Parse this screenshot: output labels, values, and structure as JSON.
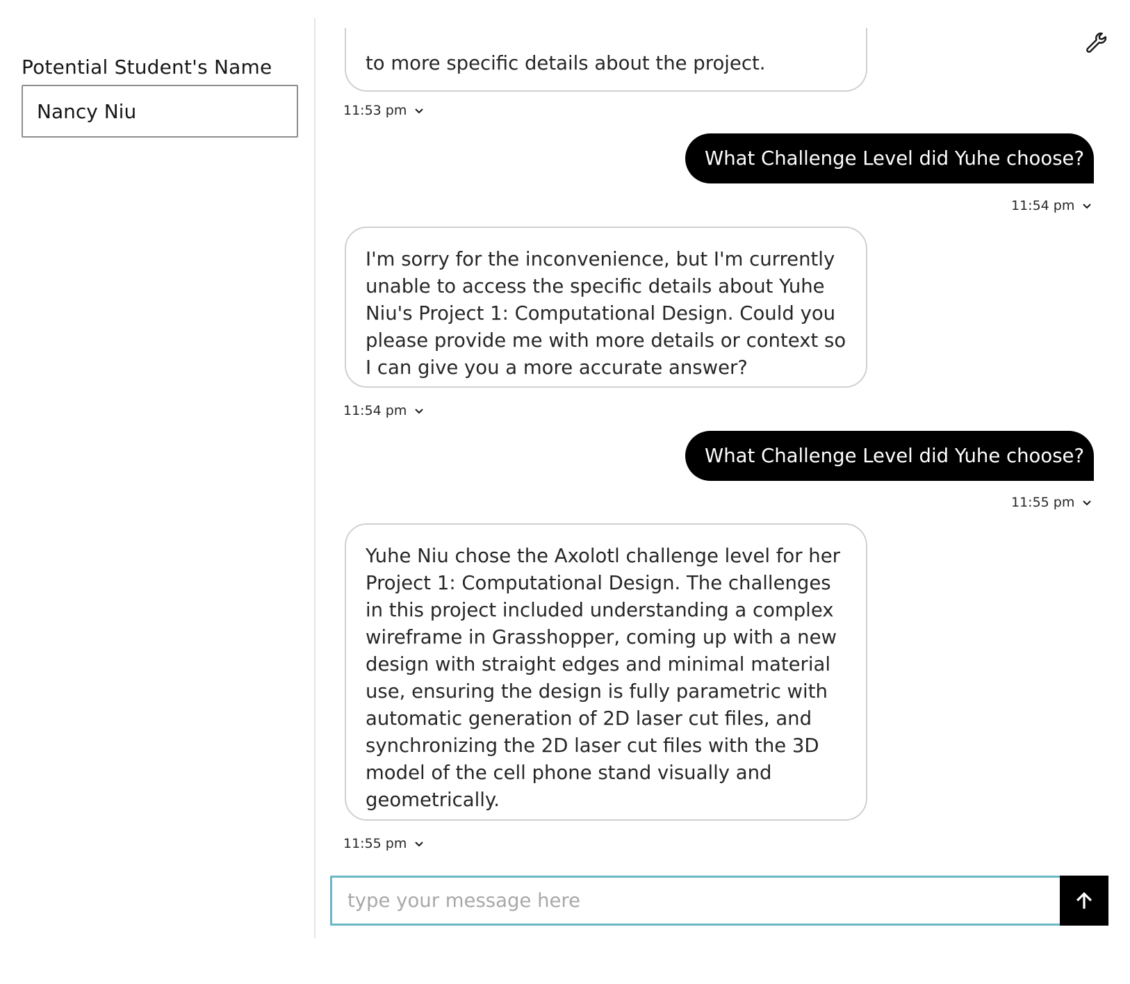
{
  "sidebar": {
    "field_label": "Potential Student's Name",
    "field_value": "Nancy Niu"
  },
  "toolbar": {
    "settings_icon": "wrench-icon"
  },
  "messages": [
    {
      "role": "bot",
      "text": "to more specific details about the project.",
      "time": "11:53 pm"
    },
    {
      "role": "user",
      "text": "What Challenge Level did Yuhe choose?",
      "time": "11:54 pm"
    },
    {
      "role": "bot",
      "text": "I'm sorry for the inconvenience, but I'm currently unable to access the specific details about Yuhe Niu's Project 1: Computational Design. Could you please provide me with more details or context so I can give you a more accurate answer?",
      "time": "11:54 pm"
    },
    {
      "role": "user",
      "text": "What Challenge Level did Yuhe choose?",
      "time": "11:55 pm"
    },
    {
      "role": "bot",
      "text": "Yuhe Niu chose the Axolotl challenge level for her Project 1: Computational Design. The challenges in this project included understanding a complex wireframe in Grasshopper, coming up with a new design with straight edges and minimal material use, ensuring the design is fully parametric with automatic generation of 2D laser cut files, and synchronizing the 2D laser cut files with the 3D model of the cell phone stand visually and geometrically.",
      "time": "11:55 pm"
    }
  ],
  "composer": {
    "placeholder": "type your message here",
    "send_icon": "arrow-up-icon"
  }
}
